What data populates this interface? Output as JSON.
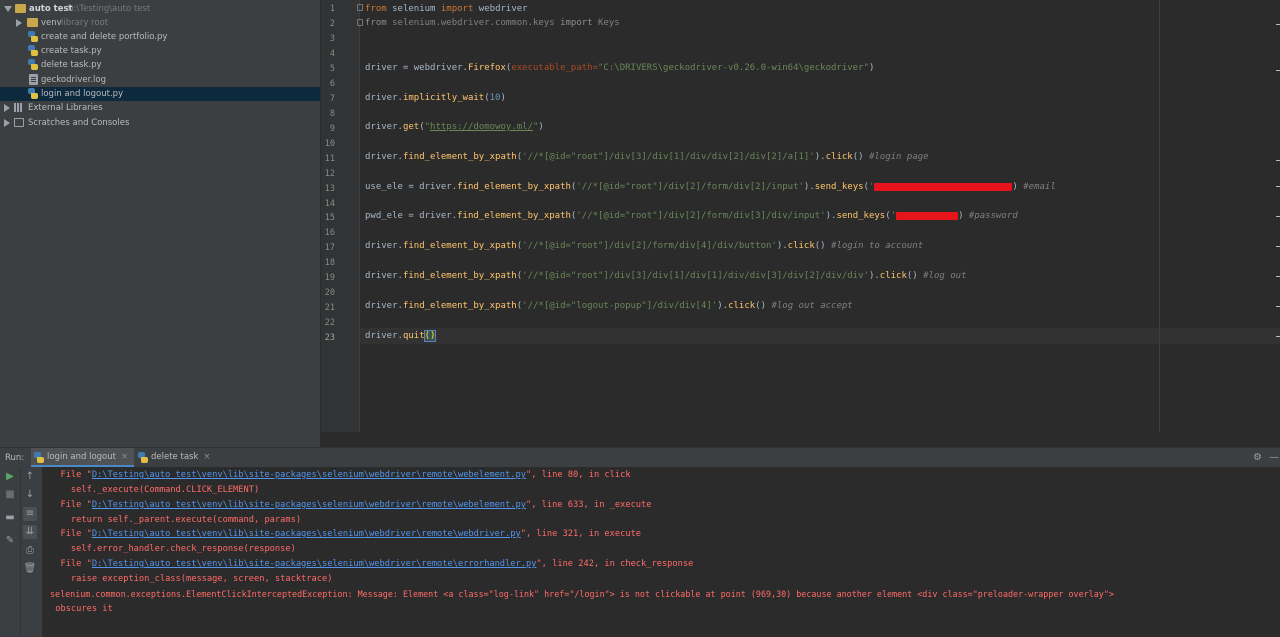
{
  "project": {
    "root": {
      "name": "auto test",
      "path": "D:\\Testing\\auto test"
    },
    "items": [
      {
        "name": "venv",
        "suffix": "library root",
        "kind": "folder"
      },
      {
        "name": "create and delete portfolio.py",
        "kind": "py"
      },
      {
        "name": "create task.py",
        "kind": "py"
      },
      {
        "name": "delete task.py",
        "kind": "py"
      },
      {
        "name": "geckodriver.log",
        "kind": "log"
      },
      {
        "name": "login and logout.py",
        "kind": "py",
        "selected": true
      }
    ],
    "external_libraries": "External Libraries",
    "scratches": "Scratches and Consoles"
  },
  "editor": {
    "line_numbers": [
      "1",
      "2",
      "3",
      "4",
      "5",
      "6",
      "7",
      "8",
      "9",
      "10",
      "11",
      "12",
      "13",
      "14",
      "15",
      "16",
      "17",
      "18",
      "19",
      "20",
      "21",
      "22",
      "23"
    ],
    "current_line": 23,
    "l1": {
      "kw1": "from",
      "mod": " selenium ",
      "kw2": "import",
      "name": " webdriver"
    },
    "l2": {
      "kw1": "from",
      "mod": " selenium.webdriver.common.keys ",
      "kw2": "import",
      "name": " Keys"
    },
    "l5": {
      "a": "driver = webdriver.",
      "fn": "Firefox",
      "b": "(",
      "param": "executable_path=",
      "str": "\"C:\\DRIVERS\\geckodriver-v0.26.0-win64\\geckodriver\"",
      "c": ")"
    },
    "l7": {
      "a": "driver.",
      "fn": "implicitly_wait",
      "b": "(",
      "num": "10",
      "c": ")"
    },
    "l9": {
      "a": "driver.",
      "fn": "get",
      "b": "(",
      "q1": "\"",
      "url": "https://domowoy.ml/",
      "q2": "\"",
      "c": ")"
    },
    "l11": {
      "a": "driver.",
      "fn": "find_element_by_xpath",
      "b": "(",
      "str": "'//*[@id=\"root\"]/div[3]/div[1]/div/div[2]/div[2]/a[1]'",
      "c": ").",
      "fn2": "click",
      "d": "() ",
      "cmt": "#login page"
    },
    "l13": {
      "a": "use_ele = driver.",
      "fn": "find_element_by_xpath",
      "b": "(",
      "str": "'//*[@id=\"root\"]/div[2]/form/div[2]/input'",
      "c": ").",
      "fn2": "send_keys",
      "d": "(",
      "q1": "'",
      "e": ") ",
      "cmt": "#email"
    },
    "l15": {
      "a": "pwd_ele = driver.",
      "fn": "find_element_by_xpath",
      "b": "(",
      "str": "'//*[@id=\"root\"]/div[2]/form/div[3]/div/input'",
      "c": ").",
      "fn2": "send_keys",
      "d": "(",
      "q1": "'",
      "e": ") ",
      "cmt": "#password"
    },
    "l17": {
      "a": "driver.",
      "fn": "find_element_by_xpath",
      "b": "(",
      "str": "'//*[@id=\"root\"]/div[2]/form/div[4]/div/button'",
      "c": ").",
      "fn2": "click",
      "d": "() ",
      "cmt": "#login to account"
    },
    "l19": {
      "a": "driver.",
      "fn": "find_element_by_xpath",
      "b": "(",
      "str": "'//*[@id=\"root\"]/div[3]/div[1]/div[1]/div/div[3]/div[2]/div/div'",
      "c": ").",
      "fn2": "click",
      "d": "() ",
      "cmt": "#log out"
    },
    "l21": {
      "a": "driver.",
      "fn": "find_element_by_xpath",
      "b": "(",
      "str": "'//*[@id=\"logout-popup\"]/div/div[4]'",
      "c": ").",
      "fn2": "click",
      "d": "() ",
      "cmt": "#log out accept"
    },
    "l23": {
      "a": "driver.",
      "fn": "quit",
      "b": "()"
    }
  },
  "run": {
    "label": "Run:",
    "tabs": [
      {
        "label": "login and logout",
        "active": true,
        "close": "×"
      },
      {
        "label": "delete task",
        "active": false,
        "close": "×"
      }
    ],
    "console": [
      {
        "pre": "  File \"",
        "link": "D:\\Testing\\auto test\\venv\\lib\\site-packages\\selenium\\webdriver\\remote\\webelement.py",
        "post": "\", line 80, in click"
      },
      {
        "text": "    self._execute(Command.CLICK_ELEMENT)"
      },
      {
        "pre": "  File \"",
        "link": "D:\\Testing\\auto test\\venv\\lib\\site-packages\\selenium\\webdriver\\remote\\webelement.py",
        "post": "\", line 633, in _execute"
      },
      {
        "text": "    return self._parent.execute(command, params)"
      },
      {
        "pre": "  File \"",
        "link": "D:\\Testing\\auto test\\venv\\lib\\site-packages\\selenium\\webdriver\\remote\\webdriver.py",
        "post": "\", line 321, in execute"
      },
      {
        "text": "    self.error_handler.check_response(response)"
      },
      {
        "pre": "  File \"",
        "link": "D:\\Testing\\auto test\\venv\\lib\\site-packages\\selenium\\webdriver\\remote\\errorhandler.py",
        "post": "\", line 242, in check_response"
      },
      {
        "text": "    raise exception_class(message, screen, stacktrace)"
      },
      {
        "text": "selenium.common.exceptions.ElementClickInterceptedException: Message: Element <a class=\"log-link\" href=\"/login\"> is not clickable at point (969,30) because another element <div class=\"preloader-wrapper overlay\">"
      },
      {
        "text": " obscures it"
      }
    ]
  }
}
